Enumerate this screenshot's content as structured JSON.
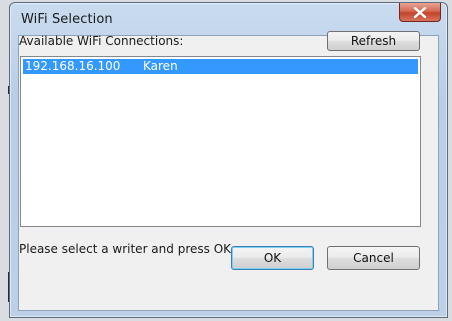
{
  "window": {
    "title": "WiFi Selection"
  },
  "dialog": {
    "connections_label": "Available WiFi Connections:",
    "refresh_label": "Refresh",
    "connections": [
      {
        "ip": "192.168.16.100",
        "name": "Karen",
        "selected": true
      }
    ],
    "status_text": "Please select a writer and press OK.",
    "ok_label": "OK",
    "cancel_label": "Cancel"
  },
  "colors": {
    "selection": "#3399ff",
    "close_button": "#c2442b"
  },
  "icons": {
    "close": "close-icon"
  }
}
